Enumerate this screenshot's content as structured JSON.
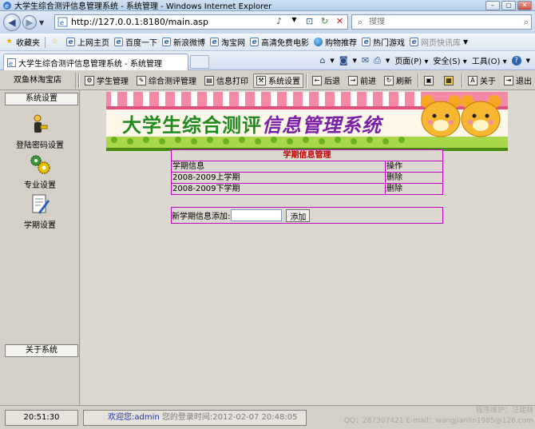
{
  "browser": {
    "window_title": "大学生综合测评信息管理系统 - 系统管理 - Windows Internet Explorer",
    "url": "http://127.0.0.1:8180/main.asp",
    "search_placeholder": "搜搜",
    "favorites_label": "收藏夹",
    "favorites": [
      {
        "label": "上网主页",
        "icon": "ie-page-icon"
      },
      {
        "label": "百度一下",
        "icon": "ie-page-icon"
      },
      {
        "label": "新浪微博",
        "icon": "ie-page-icon"
      },
      {
        "label": "淘宝网",
        "icon": "ie-page-icon"
      },
      {
        "label": "高清免费电影",
        "icon": "ie-page-icon"
      },
      {
        "label": "购物推荐",
        "icon": "globe-icon"
      },
      {
        "label": "热门游戏",
        "icon": "ie-page-icon"
      },
      {
        "label": "网页快讯库",
        "icon": "ie-page-icon"
      }
    ],
    "tab_title": "大学生综合测评信息管理系统 - 系统管理",
    "commands": {
      "page": "页面(P)",
      "safety": "安全(S)",
      "tools": "工具(O)"
    }
  },
  "app": {
    "shop_name": "双鱼林淘宝店",
    "toolbar": [
      {
        "label": "学生管理",
        "icon": "student-icon"
      },
      {
        "label": "综合测评管理",
        "icon": "assessment-icon"
      },
      {
        "label": "信息打印",
        "icon": "print-icon"
      },
      {
        "label": "系统设置",
        "icon": "settings-icon",
        "active": true
      }
    ],
    "toolbar_right": [
      {
        "label": "后退",
        "icon": "back-arrow-icon"
      },
      {
        "label": "前进",
        "icon": "forward-arrow-icon"
      },
      {
        "label": "刷新",
        "icon": "refresh-icon"
      },
      {
        "label": "",
        "icon": "window-icon"
      },
      {
        "label": "",
        "icon": "grid-icon"
      },
      {
        "label": "关于",
        "icon": "about-icon"
      },
      {
        "label": "退出",
        "icon": "exit-icon"
      }
    ],
    "sidebar": {
      "section_title": "系统设置",
      "items": [
        {
          "label": "登陆密码设置",
          "icon": "user-key-icon"
        },
        {
          "label": "专业设置",
          "icon": "gears-icon"
        },
        {
          "label": "学期设置",
          "icon": "document-pen-icon"
        }
      ],
      "about_title": "关于系统"
    },
    "banner": {
      "title_green": "大学生综合测评",
      "title_purple": "信息管理系统"
    },
    "semester_table": {
      "caption": "学期信息管理",
      "col_info": "学期信息",
      "col_action": "操作",
      "rows": [
        {
          "info": "2008-2009上学期",
          "action": "删除"
        },
        {
          "info": "2008-2009下学期",
          "action": "删除"
        }
      ]
    },
    "add_form": {
      "label": "新学期信息添加:",
      "value": "",
      "button": "添加"
    },
    "status": {
      "clock": "20:51:30",
      "welcome_label": "欢迎您:",
      "username": "admin",
      "login_time": "您的登录时间:2012-02-07 20:48:05",
      "credit_line1": "程序维护：汪建林",
      "credit_line2": "QQ：287307421 E-mail：wangjianlin1985@126.com"
    }
  }
}
